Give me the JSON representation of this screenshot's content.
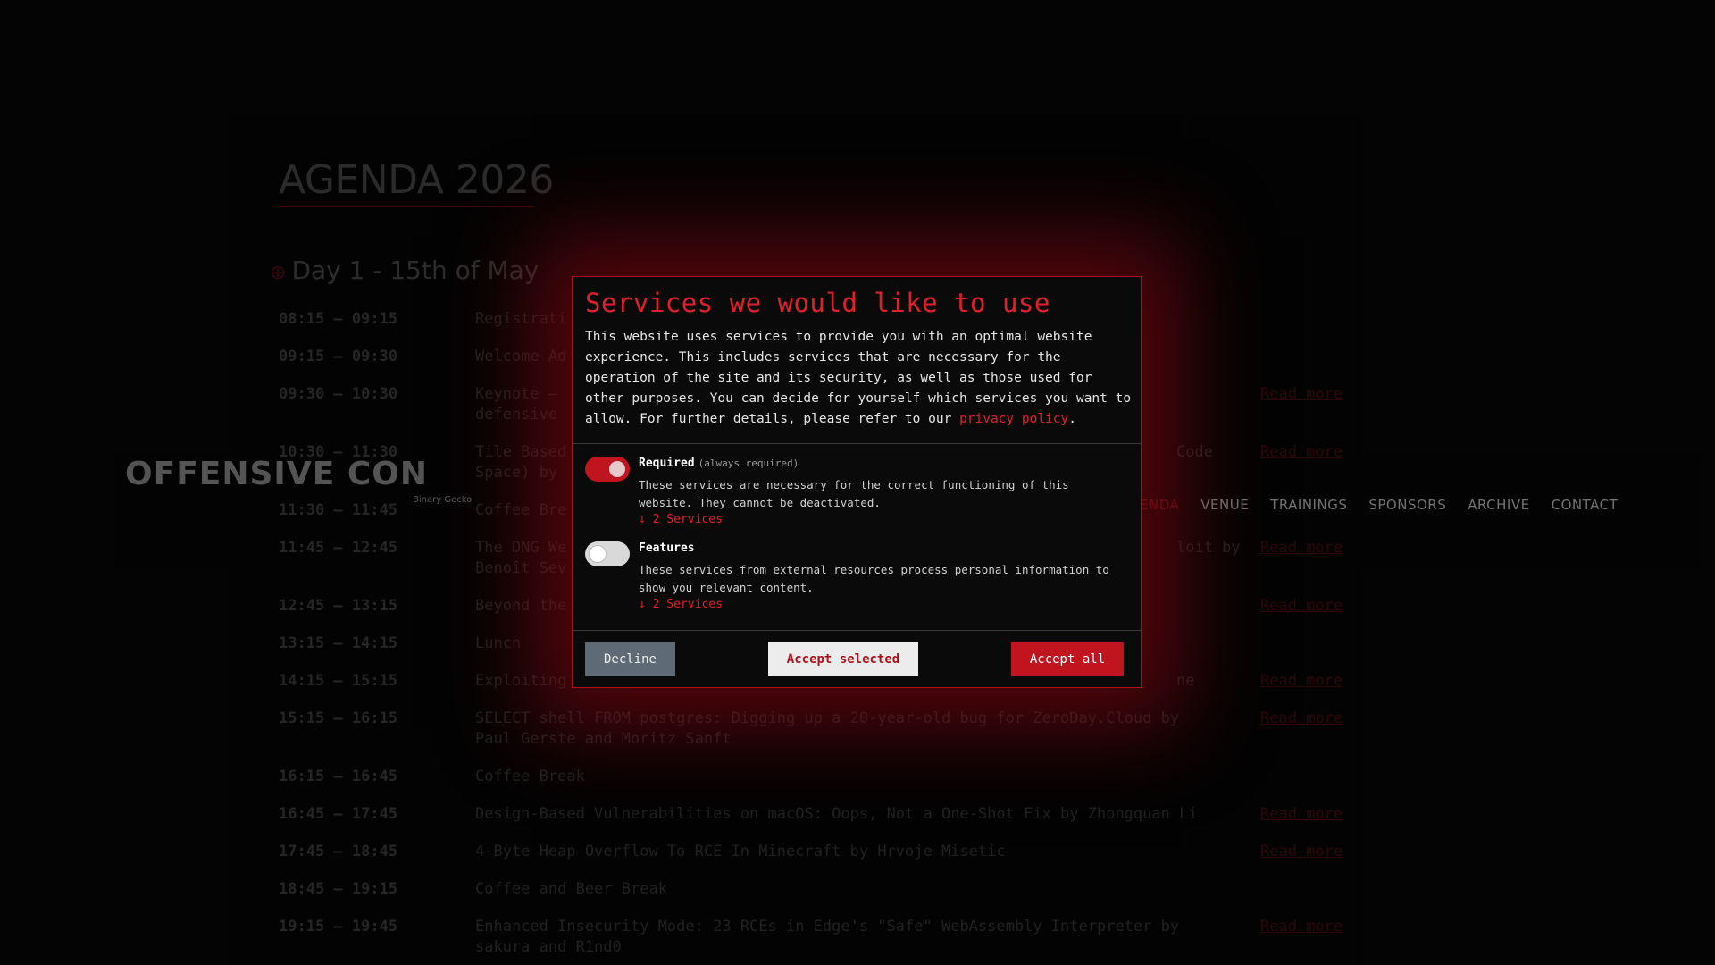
{
  "agenda": {
    "title": "AGENDA 2026",
    "day_title": "Day 1 - 15th of May",
    "read_more": "Read more",
    "rows": [
      {
        "time": "08:15 – 09:15",
        "text": "Registrati"
      },
      {
        "time": "09:15 – 09:30",
        "text": "Welcome Ad"
      },
      {
        "time": "09:30 – 10:30",
        "text": "Keynote –",
        "text2": "defensive"
      },
      {
        "time": "10:30 – 11:30",
        "text": "Tile Based",
        "tail": "Code",
        "text2": "Space) by"
      },
      {
        "time": "11:30 – 11:45",
        "text": "Coffee Bre"
      },
      {
        "time": "11:45 – 12:45",
        "text": "The DNG We",
        "tail": "loit by",
        "text2": "Benoît Sev"
      },
      {
        "time": "12:45 – 13:15",
        "text": "Beyond the"
      },
      {
        "time": "13:15 – 14:15",
        "text": "Lunch"
      },
      {
        "time": "14:15 – 15:15",
        "text": "Exploiting",
        "tail": "ne"
      },
      {
        "time": "15:15 – 16:15",
        "text": "SELECT shell FROM postgres: Digging up a 20-year-old bug for ZeroDay.Cloud by",
        "text2": "Paul Gerste and Moritz Sanft"
      },
      {
        "time": "16:15 – 16:45",
        "text": "Coffee Break"
      },
      {
        "time": "16:45 – 17:45",
        "text": "Design-Based Vulnerabilities on macOS: Oops, Not a One-Shot Fix by Zhongquan Li"
      },
      {
        "time": "17:45 – 18:45",
        "text": "4-Byte Heap Overflow To RCE In Minecraft by Hrvoje Misetic"
      },
      {
        "time": "18:45 – 19:15",
        "text": "Coffee and Beer Break"
      },
      {
        "time": "19:15 – 19:45",
        "text": "Enhanced Insecurity Mode: 23 RCEs in Edge's \"Safe\" WebAssembly Interpreter by",
        "text2": "sakura and R1nd0"
      }
    ]
  },
  "logo": {
    "text": "OFFENSIVE CON",
    "sub": "Binary Gecko"
  },
  "nav": {
    "items": [
      "ENDA",
      "VENUE",
      "TRAININGS",
      "SPONSORS",
      "ARCHIVE",
      "CONTACT"
    ]
  },
  "consent": {
    "title": "Services we would like to use",
    "intro_prefix": "This website uses services to provide you with an optimal website experience. This includes services that are necessary for the operation of the site and its security, as well as those used for other purposes. You can decide for yourself which services you want to allow. For further details, please refer to our ",
    "privacy_link": "privacy policy",
    "intro_suffix": ".",
    "required": {
      "label": "Required",
      "note": "(always required)",
      "description": "These services are necessary for the correct functioning of this website. They cannot be deactivated.",
      "services_link": "↓ 2 Services",
      "enabled": true
    },
    "features": {
      "label": "Features",
      "description": "These services from external resources process personal information to show you relevant content.",
      "services_link": "↓ 2 Services",
      "enabled": false
    },
    "buttons": {
      "decline": "Decline",
      "accept_selected": "Accept selected",
      "accept_all": "Accept all"
    }
  },
  "colors": {
    "accent": "#c0141f",
    "background": "#050505"
  }
}
